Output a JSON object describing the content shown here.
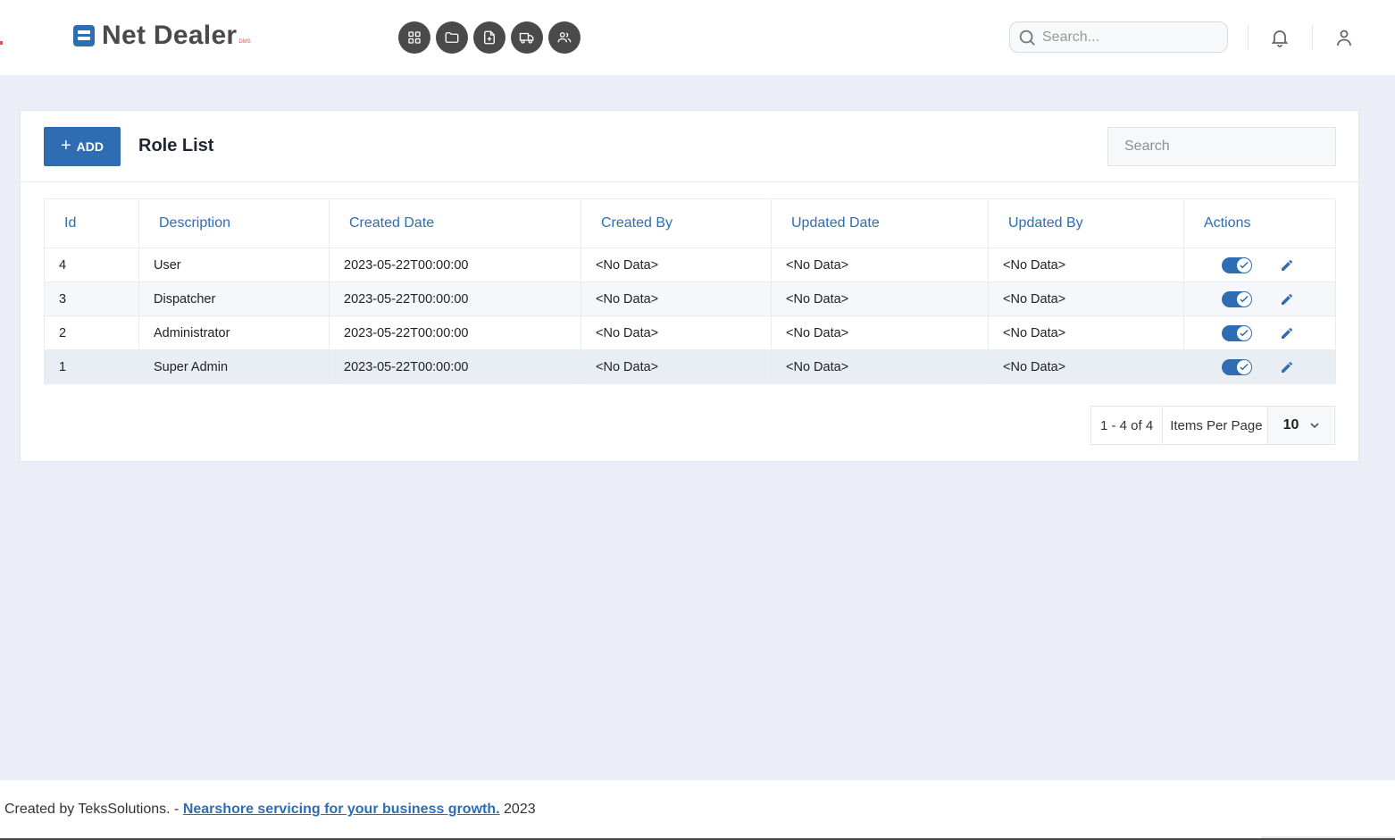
{
  "brand": {
    "name": "Net Dealer",
    "sub": "DMS"
  },
  "nav_icons": [
    {
      "name": "dashboard-grid-icon"
    },
    {
      "name": "folder-icon"
    },
    {
      "name": "file-add-icon"
    },
    {
      "name": "truck-icon"
    },
    {
      "name": "users-icon"
    }
  ],
  "header": {
    "search_placeholder": "Search...",
    "notification_icon": "bell-icon",
    "profile_icon": "user-icon"
  },
  "card": {
    "add_label": "ADD",
    "title": "Role List",
    "search_placeholder": "Search"
  },
  "table": {
    "columns": [
      "Id",
      "Description",
      "Created Date",
      "Created By",
      "Updated Date",
      "Updated By",
      "Actions"
    ],
    "rows": [
      {
        "id": "4",
        "description": "User",
        "created_date": "2023-05-22T00:00:00",
        "created_by": "<No Data>",
        "updated_date": "<No Data>",
        "updated_by": "<No Data>",
        "active": true
      },
      {
        "id": "3",
        "description": "Dispatcher",
        "created_date": "2023-05-22T00:00:00",
        "created_by": "<No Data>",
        "updated_date": "<No Data>",
        "updated_by": "<No Data>",
        "active": true
      },
      {
        "id": "2",
        "description": "Administrator",
        "created_date": "2023-05-22T00:00:00",
        "created_by": "<No Data>",
        "updated_date": "<No Data>",
        "updated_by": "<No Data>",
        "active": true
      },
      {
        "id": "1",
        "description": "Super Admin",
        "created_date": "2023-05-22T00:00:00",
        "created_by": "<No Data>",
        "updated_date": "<No Data>",
        "updated_by": "<No Data>",
        "active": true
      }
    ]
  },
  "pager": {
    "range": "1 - 4 of 4",
    "items_per_page_label": "Items Per Page",
    "page_size": "10"
  },
  "footer": {
    "prefix": "Created by TeksSolutions. -",
    "link": "Nearshore servicing for your business growth.",
    "suffix": "2023"
  },
  "colors": {
    "accent": "#2f6db3",
    "nav_icon_bg": "#4a4a4a",
    "page_bg": "#ebeef6"
  }
}
